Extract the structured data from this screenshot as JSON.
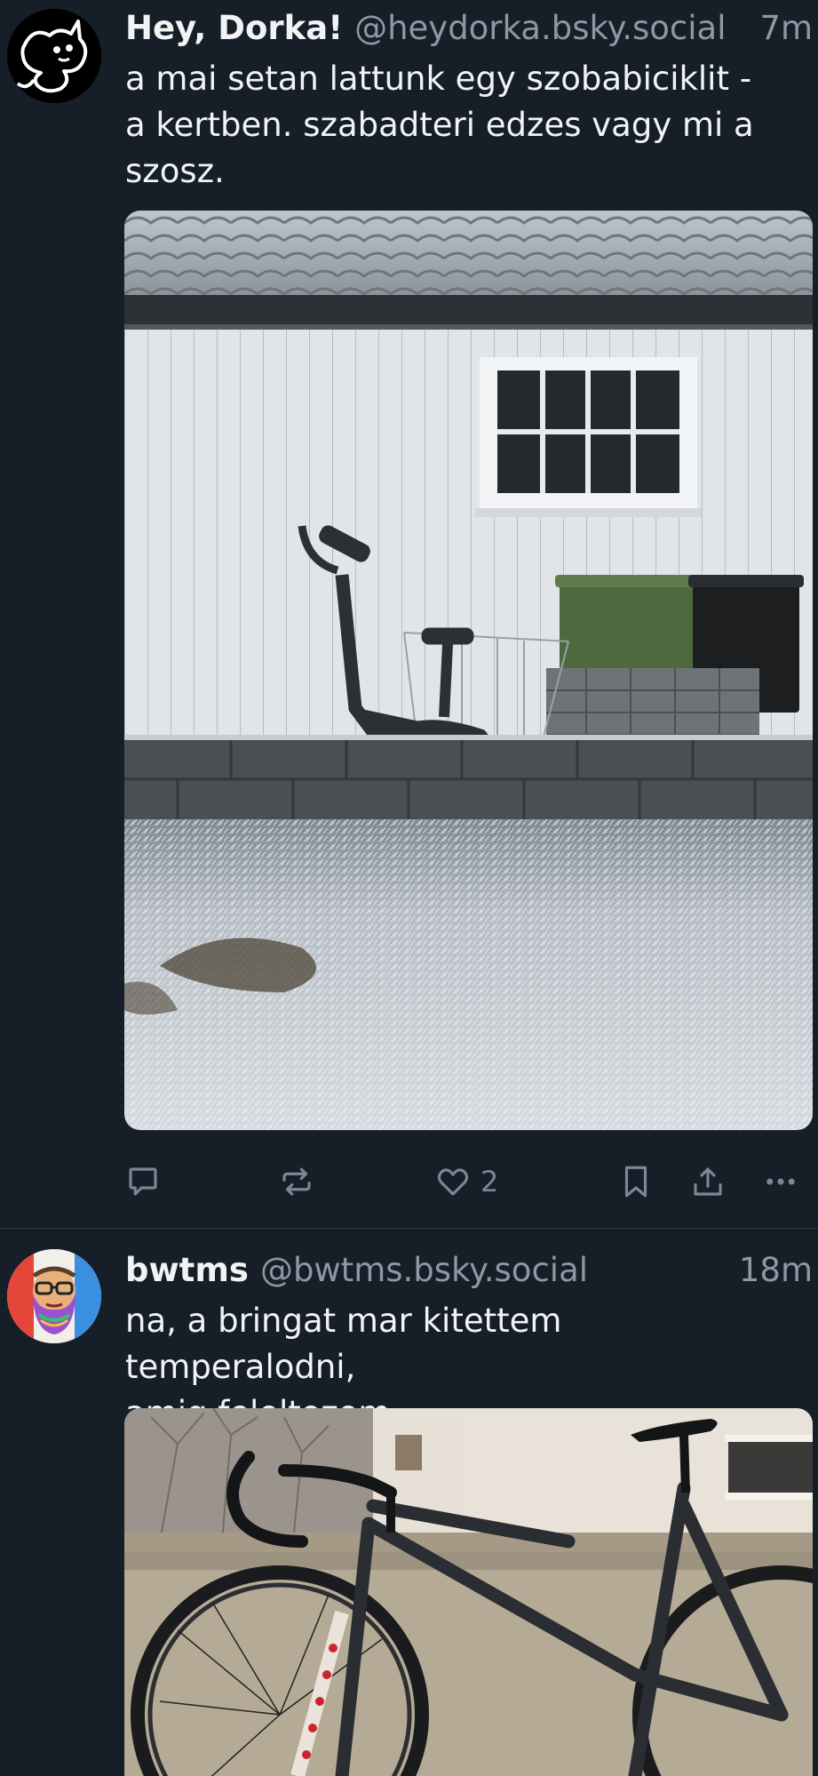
{
  "posts": [
    {
      "display_name": "Hey, Dorka!",
      "handle": "@heydorka.bsky.social",
      "time": "7m",
      "text": "a mai setan lattunk egy szobabiciklit -\na kertben. szabadteri edzes vagy mi a\nszosz.",
      "media": "photo of an exercise bike on frosty grass beside a white shed with bins and stacked paving stones",
      "likes": "2"
    },
    {
      "display_name": "bwtms",
      "handle": "@bwtms.bsky.social",
      "time": "18m",
      "text": "na, a bringat mar kitettem temperalodni,\namig feloltozom...",
      "media": "photo of a dark road bike with Cinelli fork leaning on a balcony wall"
    }
  ],
  "icons": {
    "reply": "reply-icon",
    "repost": "repost-icon",
    "like": "heart-icon",
    "bookmark": "bookmark-icon",
    "share": "share-icon",
    "more": "more-icon"
  }
}
